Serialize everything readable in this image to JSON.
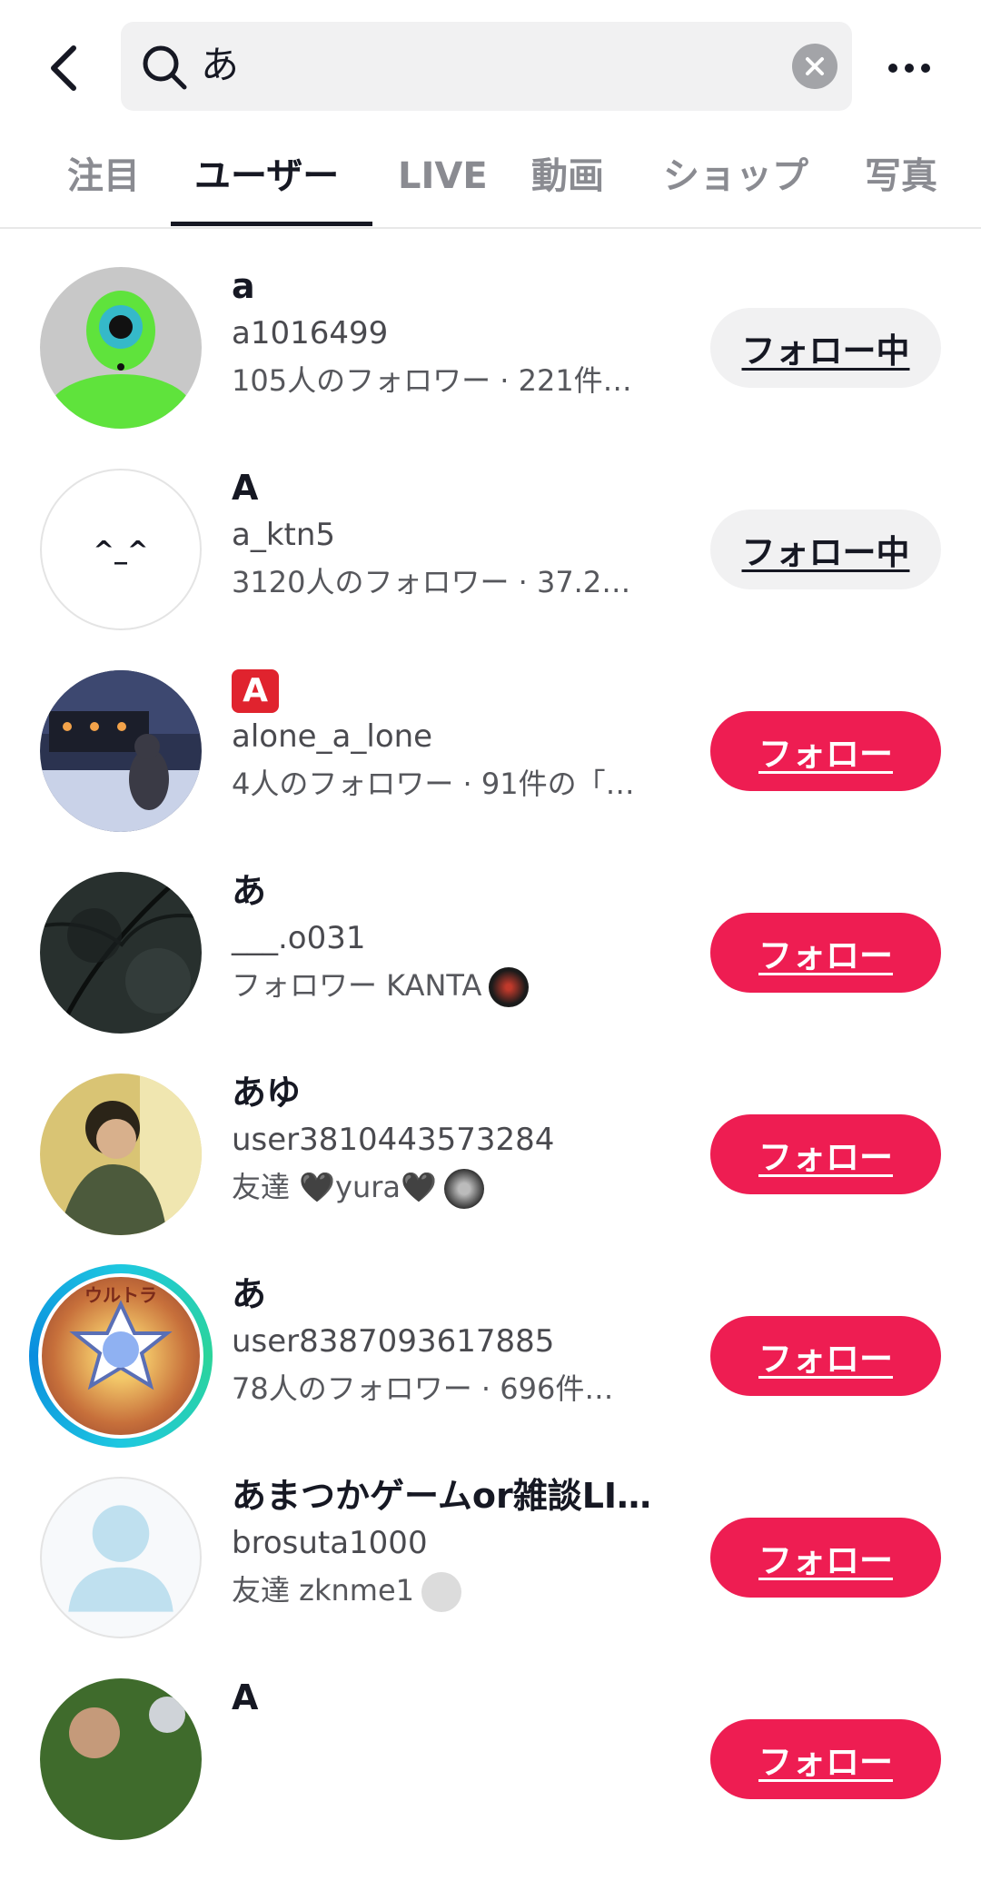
{
  "search": {
    "query": "あ"
  },
  "tabs": [
    {
      "label": "注目"
    },
    {
      "label": "ユーザー"
    },
    {
      "label": "LIVE"
    },
    {
      "label": "動画"
    },
    {
      "label": "ショップ"
    },
    {
      "label": "写真"
    }
  ],
  "active_tab": "ユーザー",
  "users": [
    {
      "name": "a",
      "handle": "a1016499",
      "meta": "105人のフォロワー · 221件…",
      "button": "フォロー中"
    },
    {
      "name": "A",
      "handle": "a_ktn5",
      "meta": "3120人のフォロワー · 37.2…",
      "button": "フォロー中",
      "avatar_text": "^_^"
    },
    {
      "name": "🅰",
      "handle": "alone_a_lone",
      "meta": "4人のフォロワー · 91件の「…",
      "button": "フォロー"
    },
    {
      "name": "あ",
      "handle": "___.o031",
      "meta": "フォロワー KANTA",
      "button": "フォロー"
    },
    {
      "name": "あゆ",
      "handle": "user3810443573284",
      "meta": "友達 🖤yura🖤",
      "button": "フォロー"
    },
    {
      "name": "あ",
      "handle": "user8387093617885",
      "meta": "78人のフォロワー · 696件…",
      "button": "フォロー",
      "avatar_text": "ウルトラ"
    },
    {
      "name": "あまつかゲームor雑談LI…",
      "handle": "brosuta1000",
      "meta": "友達 zknme1",
      "button": "フォロー"
    },
    {
      "name": "A",
      "handle": "",
      "meta": "",
      "button": "フォロー"
    }
  ],
  "colors": {
    "follow": "#ee1d52",
    "following": "#f1f1f2",
    "text": "#161823"
  }
}
